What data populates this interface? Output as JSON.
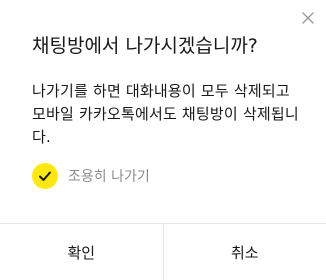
{
  "dialog": {
    "title": "채팅방에서 나가시겠습니까?",
    "message": "나가기를 하면 대화내용이 모두 삭제되고 모바일 카카오톡에서도 채팅방이 삭제됩니다.",
    "close_icon": "close-icon",
    "quiet_leave": {
      "label": "조용히 나가기",
      "checked": true,
      "icon": "checkmark-icon"
    },
    "buttons": {
      "confirm_label": "확인",
      "cancel_label": "취소"
    }
  },
  "colors": {
    "accent": "#ffe812",
    "check_mark": "#191919",
    "text": "#191919",
    "muted_text": "#8c8c8c",
    "divider": "#e6e6e6",
    "close_icon": "#9a9a9a"
  }
}
